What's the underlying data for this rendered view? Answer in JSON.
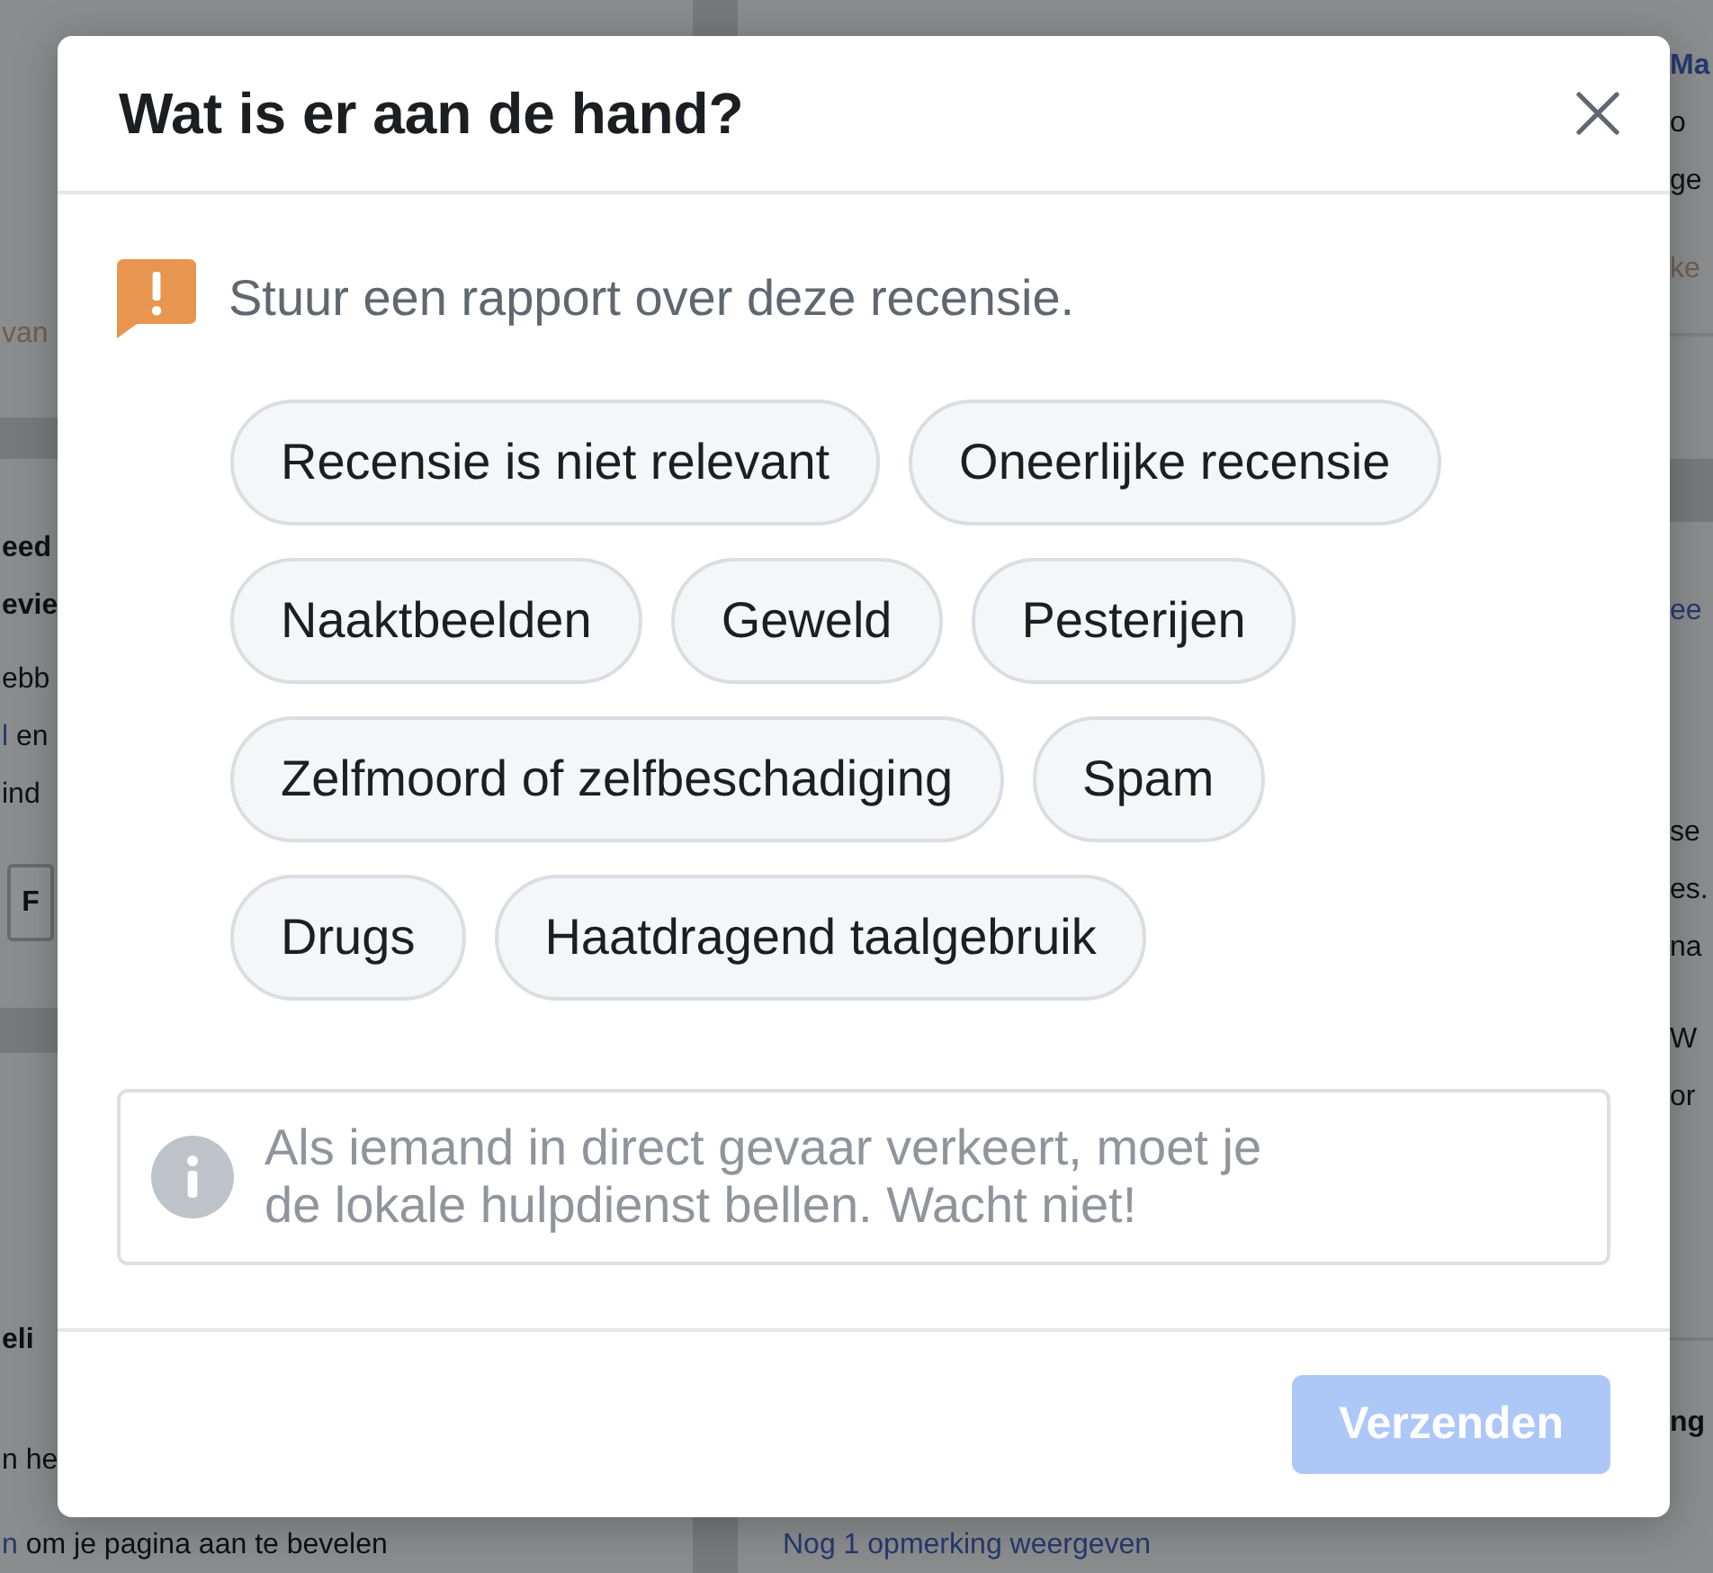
{
  "background_page": {
    "left_cards": [
      {
        "lines": [
          {
            "kind": "meta",
            "text": "van"
          }
        ]
      },
      {
        "lines": [
          {
            "kind": "heading",
            "text": "eed"
          },
          {
            "kind": "heading",
            "text": "evie"
          },
          {
            "kind": "body",
            "text": "ebb"
          },
          {
            "kind": "linked",
            "link": "l",
            "text": "en"
          },
          {
            "kind": "body",
            "text": "ind"
          }
        ],
        "button": "F"
      },
      {
        "lines": [
          {
            "kind": "heading",
            "text": "eli"
          },
          {
            "kind": "body",
            "text": "n he"
          }
        ],
        "footer": {
          "link": "n",
          "text": "om je pagina aan te bevelen"
        }
      }
    ],
    "right_cards": [
      {
        "lines": [
          {
            "kind": "link_heading",
            "text": "Ma"
          },
          {
            "kind": "body",
            "text": "o"
          },
          {
            "kind": "body",
            "text": "ge"
          },
          {
            "kind": "meta",
            "text": "ke"
          }
        ]
      },
      {
        "lines": [
          {
            "kind": "link",
            "text": "ee"
          },
          {
            "kind": "body",
            "text": "se"
          },
          {
            "kind": "body",
            "text": "es."
          },
          {
            "kind": "body",
            "text": "na"
          },
          {
            "kind": "body",
            "text": "W"
          },
          {
            "kind": "body",
            "text": "or"
          }
        ]
      },
      {
        "lines": [
          {
            "kind": "heading",
            "text": "ng"
          }
        ],
        "more_link": "Nog 1 opmerking weergeven"
      }
    ]
  },
  "dialog": {
    "title": "Wat is er aan de hand?",
    "intro": "Stuur een rapport over deze recensie.",
    "options": [
      {
        "label": "Recensie is niet relevant",
        "selected": false
      },
      {
        "label": "Oneerlijke recensie",
        "selected": false
      },
      {
        "label": "Naaktbeelden",
        "selected": false
      },
      {
        "label": "Geweld",
        "selected": false
      },
      {
        "label": "Pesterijen",
        "selected": false
      },
      {
        "label": "Zelfmoord of zelfbeschadiging",
        "selected": false
      },
      {
        "label": "Spam",
        "selected": false
      },
      {
        "label": "Drugs",
        "selected": false
      },
      {
        "label": "Haatdragend taalgebruik",
        "selected": false
      }
    ],
    "notice": "Als iemand in direct gevaar verkeert, moet je de lokale hulpdienst bellen. Wacht niet!",
    "submit": {
      "label": "Verzenden",
      "disabled": true
    }
  }
}
